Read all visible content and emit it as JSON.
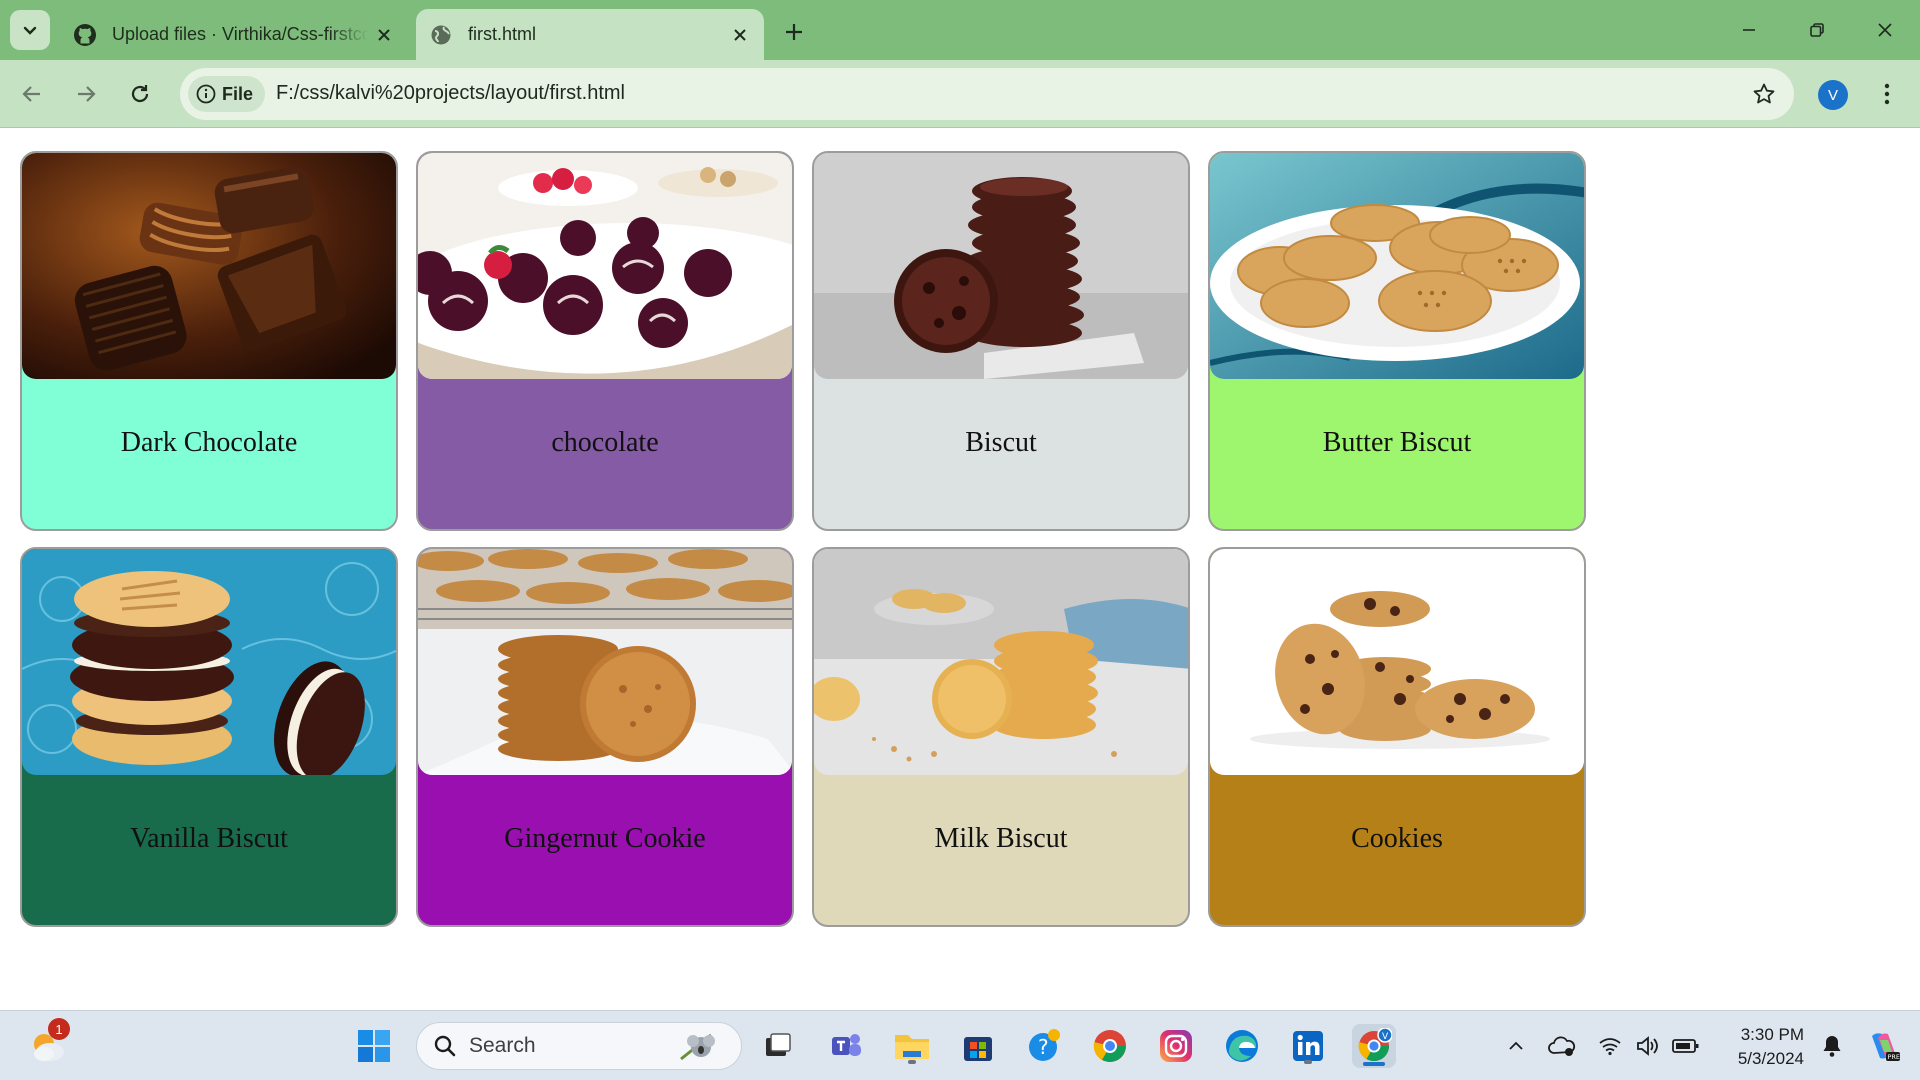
{
  "browser": {
    "tabs": [
      {
        "title": "Upload files · Virthika/Css-firstcode",
        "favicon": "github-icon",
        "active": false
      },
      {
        "title": "first.html",
        "favicon": "globe-icon",
        "active": true
      }
    ],
    "address": {
      "security_chip": "File",
      "url": "F:/css/kalvi%20projects/layout/first.html"
    },
    "profile_initial": "V"
  },
  "page": {
    "cards": [
      {
        "label": "Dark Chocolate",
        "bg": "#80ffd6",
        "image": "dark-chocolate-photo"
      },
      {
        "label": "chocolate",
        "bg": "#865ba6",
        "image": "chocolate-truffles-photo"
      },
      {
        "label": "Biscut",
        "bg": "#dce1e1",
        "image": "biscuit-stack-photo"
      },
      {
        "label": "Butter Biscut",
        "bg": "#9ef56e",
        "image": "butter-biscuit-plate-photo"
      },
      {
        "label": "Vanilla Biscut",
        "bg": "#186c4b",
        "image": "vanilla-sandwich-biscuit-photo"
      },
      {
        "label": "Gingernut Cookie",
        "bg": "#990fb0",
        "image": "gingernut-cookie-photo"
      },
      {
        "label": "Milk Biscut",
        "bg": "#dfd8b9",
        "image": "milk-biscuit-photo"
      },
      {
        "label": "Cookies",
        "bg": "#b58018",
        "image": "chocolate-chip-cookies-photo"
      }
    ]
  },
  "taskbar": {
    "search_placeholder": "Search",
    "weather_badge": "1",
    "time": "3:30 PM",
    "date": "5/3/2024",
    "apps": [
      "windows-start-icon",
      "task-view-icon",
      "teams-icon",
      "file-explorer-icon",
      "microsoft-store-icon",
      "get-help-icon",
      "chrome-icon",
      "instagram-icon",
      "edge-icon",
      "linkedin-icon",
      "chrome-profile-icon"
    ]
  }
}
